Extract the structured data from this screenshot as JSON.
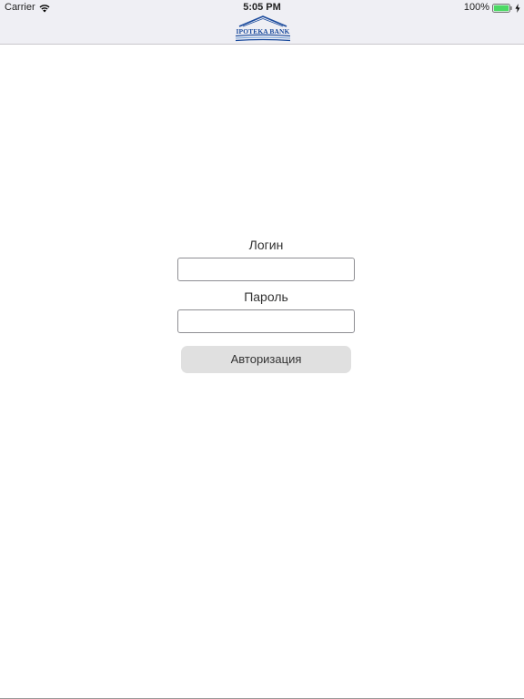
{
  "status_bar": {
    "carrier": "Carrier",
    "time": "5:05 PM",
    "battery_percent": "100%",
    "battery_level": 1.0,
    "battery_color": "#4cd964"
  },
  "header": {
    "logo_text": "IPOTEKA BANK",
    "logo_color": "#1a4a9c",
    "background": "#efeff4"
  },
  "login_form": {
    "login_label": "Логин",
    "login_value": "",
    "password_label": "Пароль",
    "password_value": "",
    "submit_label": "Авторизация"
  },
  "icons": {
    "wifi": "wifi-icon",
    "battery": "battery-icon",
    "charging": "bolt-icon",
    "logo": "bank-logo-icon"
  }
}
